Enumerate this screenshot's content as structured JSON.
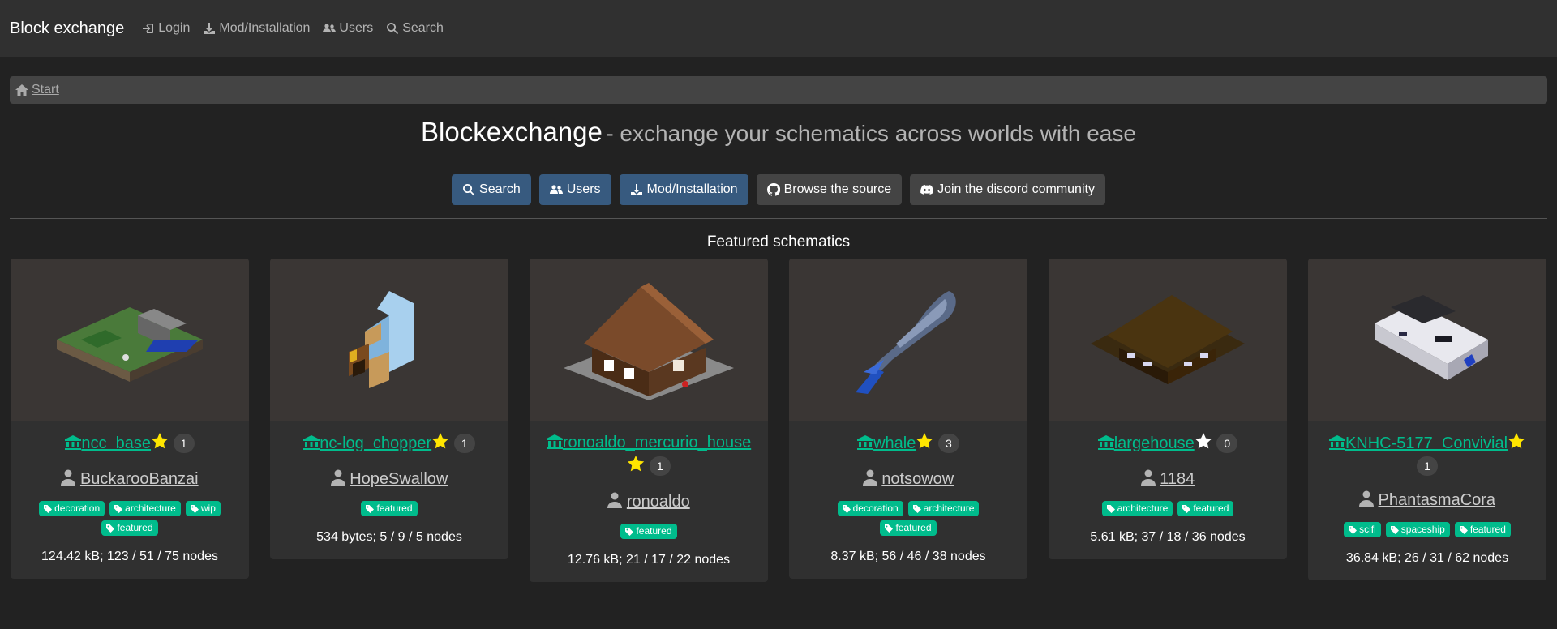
{
  "navbar": {
    "brand": "Block exchange",
    "links": [
      "Login",
      "Mod/Installation",
      "Users",
      "Search"
    ]
  },
  "breadcrumb": {
    "start": "Start"
  },
  "hero": {
    "title": "Blockexchange",
    "subtitle": "- exchange your schematics across worlds with ease"
  },
  "buttons": {
    "search": "Search",
    "users": "Users",
    "mod": "Mod/Installation",
    "source": "Browse the source",
    "discord": "Join the discord community"
  },
  "featured_title": "Featured schematics",
  "cards": [
    {
      "name": "ncc_base",
      "stars": "1",
      "owner": "BuckarooBanzai",
      "tags": [
        "decoration",
        "architecture",
        "wip",
        "featured"
      ],
      "stats": "124.42 kB; 123 / 51 / 75 nodes"
    },
    {
      "name": "nc-log_chopper",
      "stars": "1",
      "owner": "HopeSwallow",
      "tags": [
        "featured"
      ],
      "stats": "534 bytes; 5 / 9 / 5 nodes"
    },
    {
      "name": "ronoaldo_mercurio_house",
      "stars": "1",
      "owner": "ronoaldo",
      "tags": [
        "featured"
      ],
      "stats": "12.76 kB; 21 / 17 / 22 nodes"
    },
    {
      "name": "whale",
      "stars": "3",
      "owner": "notsowow",
      "tags": [
        "decoration",
        "architecture",
        "featured"
      ],
      "stats": "8.37 kB; 56 / 46 / 38 nodes"
    },
    {
      "name": "largehouse",
      "stars": "0",
      "owner": "1184",
      "tags": [
        "architecture",
        "featured"
      ],
      "stats": "5.61 kB; 37 / 18 / 36 nodes"
    },
    {
      "name": "KNHC-5177_Convivial",
      "stars": "1",
      "owner": "PhantasmaCora",
      "tags": [
        "scifi",
        "spaceship",
        "featured"
      ],
      "stats": "36.84 kB; 26 / 31 / 62 nodes"
    }
  ],
  "icons": {
    "schematic": "bank-icon",
    "star": "star-icon",
    "owner": "user-icon",
    "tag": "tag-icon"
  },
  "colors": {
    "accent": "#00bc8c",
    "primary": "#375a7f",
    "star_filled": "#ffe500",
    "star_empty": "#ffffff"
  }
}
